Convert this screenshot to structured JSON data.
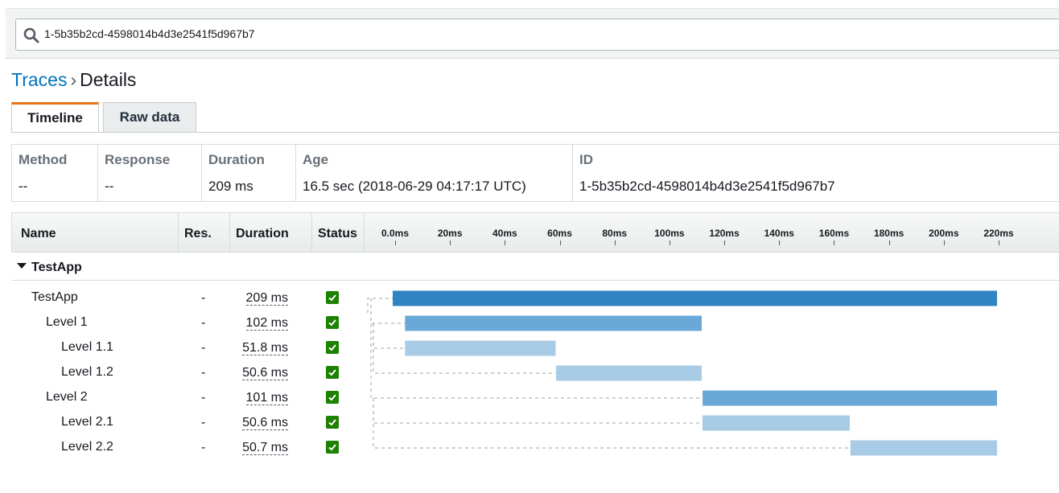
{
  "search": {
    "value": "1-5b35b2cd-4598014b4d3e2541f5d967b7"
  },
  "breadcrumb": {
    "link": "Traces",
    "separator": "›",
    "current": "Details"
  },
  "tabs": [
    {
      "label": "Timeline",
      "active": true
    },
    {
      "label": "Raw data",
      "active": false
    }
  ],
  "summary": {
    "columns": [
      {
        "header": "Method",
        "value": "--"
      },
      {
        "header": "Response",
        "value": "--"
      },
      {
        "header": "Duration",
        "value": "209 ms"
      },
      {
        "header": "Age",
        "value": "16.5 sec (2018-06-29 04:17:17 UTC)"
      },
      {
        "header": "ID",
        "value": "1-5b35b2cd-4598014b4d3e2541f5d967b7"
      }
    ]
  },
  "grid": {
    "headers": {
      "name": "Name",
      "res": "Res.",
      "duration": "Duration",
      "status": "Status"
    },
    "ticks": [
      "0.0ms",
      "20ms",
      "40ms",
      "60ms",
      "80ms",
      "100ms",
      "120ms",
      "140ms",
      "160ms",
      "180ms",
      "200ms",
      "220ms"
    ],
    "group": "TestApp",
    "rows": [
      {
        "name": "TestApp",
        "level": 0,
        "res": "-",
        "duration": "209 ms",
        "start": 0,
        "end": 220,
        "shade": "dark",
        "connector_from": 0
      },
      {
        "name": "Level 1",
        "level": 1,
        "res": "-",
        "duration": "102 ms",
        "start": 4.5,
        "end": 112.5,
        "shade": "mid",
        "connector_from": 1
      },
      {
        "name": "Level 1.1",
        "level": 2,
        "res": "-",
        "duration": "51.8 ms",
        "start": 4.5,
        "end": 59.3,
        "shade": "light",
        "connector_from": 2
      },
      {
        "name": "Level 1.2",
        "level": 2,
        "res": "-",
        "duration": "50.6 ms",
        "start": 59.5,
        "end": 112.5,
        "shade": "light",
        "connector_from": 2
      },
      {
        "name": "Level 2",
        "level": 1,
        "res": "-",
        "duration": "101 ms",
        "start": 112.8,
        "end": 220,
        "shade": "mid",
        "connector_from": 1
      },
      {
        "name": "Level 2.1",
        "level": 2,
        "res": "-",
        "duration": "50.6 ms",
        "start": 112.8,
        "end": 166.4,
        "shade": "light",
        "connector_from": 2
      },
      {
        "name": "Level 2.2",
        "level": 2,
        "res": "-",
        "duration": "50.7 ms",
        "start": 166.6,
        "end": 220,
        "shade": "light",
        "connector_from": 2
      }
    ]
  },
  "colors": {
    "dark": "#3184c2",
    "mid": "#6aa8d8",
    "light": "#a8cbe6",
    "status_ok": "#1d8102",
    "link": "#0073bb",
    "tab_accent": "#ec7211"
  },
  "icons": {
    "search": "search-icon",
    "status": "check-square-icon",
    "caret": "caret-down-icon"
  }
}
